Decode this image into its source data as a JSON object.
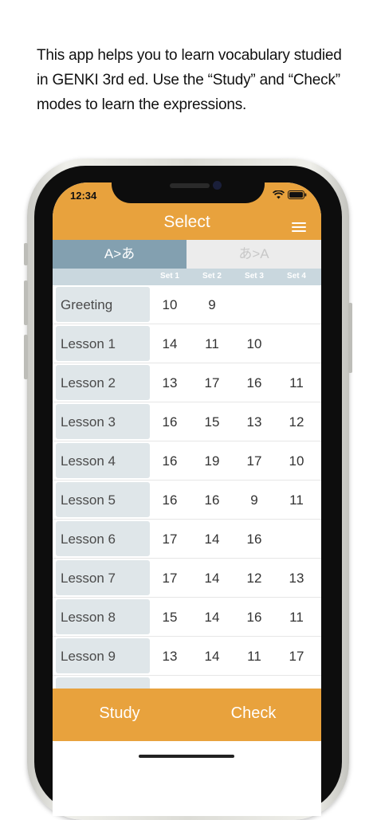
{
  "caption": {
    "lines": [
      "This app helps you to learn vocabulary studied",
      "in GENKI 3rd ed. Use the “Study” and “Check”",
      "modes to learn the expressions."
    ]
  },
  "status": {
    "time": "12:34"
  },
  "header": {
    "title": "Select",
    "menu_icon": "hamburger-icon"
  },
  "segments": {
    "a_to_kana": "A>あ",
    "kana_to_a": "あ>A",
    "selected": "A>あ"
  },
  "set_headers": [
    "Set 1",
    "Set 2",
    "Set 3",
    "Set 4"
  ],
  "rows": [
    {
      "label": "Greeting",
      "sets": [
        "10",
        "9",
        "",
        ""
      ]
    },
    {
      "label": "Lesson 1",
      "sets": [
        "14",
        "11",
        "10",
        ""
      ]
    },
    {
      "label": "Lesson 2",
      "sets": [
        "13",
        "17",
        "16",
        "11"
      ]
    },
    {
      "label": "Lesson 3",
      "sets": [
        "16",
        "15",
        "13",
        "12"
      ]
    },
    {
      "label": "Lesson 4",
      "sets": [
        "16",
        "19",
        "17",
        "10"
      ]
    },
    {
      "label": "Lesson 5",
      "sets": [
        "16",
        "16",
        "9",
        "11"
      ]
    },
    {
      "label": "Lesson 6",
      "sets": [
        "17",
        "14",
        "16",
        ""
      ]
    },
    {
      "label": "Lesson 7",
      "sets": [
        "17",
        "14",
        "12",
        "13"
      ]
    },
    {
      "label": "Lesson 8",
      "sets": [
        "15",
        "14",
        "16",
        "11"
      ]
    },
    {
      "label": "Lesson 9",
      "sets": [
        "13",
        "14",
        "11",
        "17"
      ]
    }
  ],
  "footer": {
    "study": "Study",
    "check": "Check"
  },
  "colors": {
    "accent": "#e8a23d",
    "segment_selected": "#83a0b0",
    "lesson_cell": "#dfe6e9"
  }
}
